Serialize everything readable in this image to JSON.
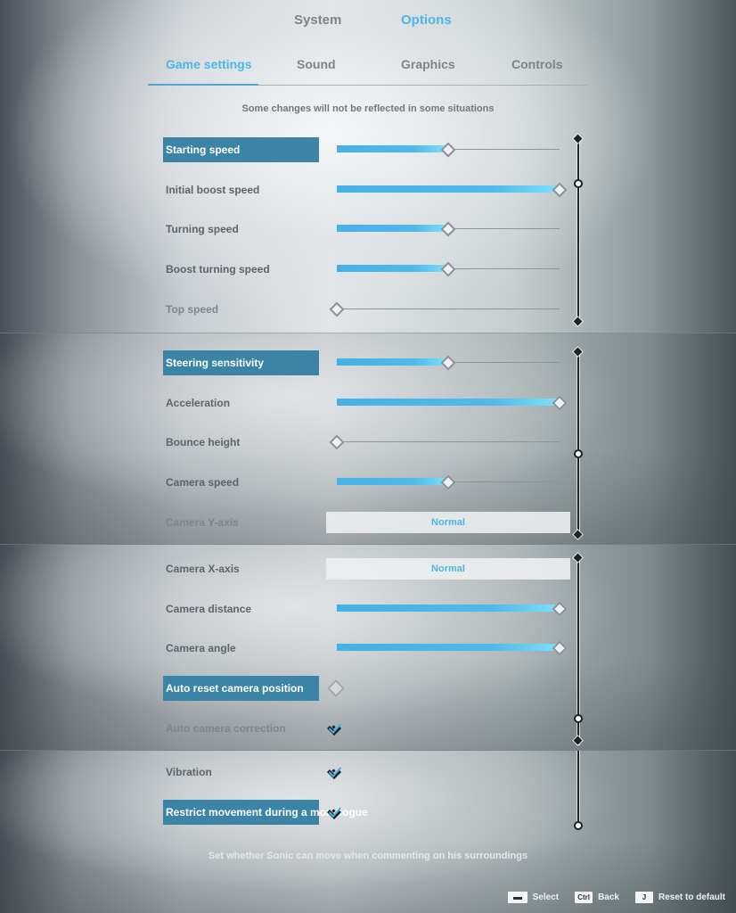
{
  "header": {
    "top_tabs": [
      {
        "label": "System",
        "active": false
      },
      {
        "label": "Options",
        "active": true
      }
    ],
    "sub_tabs": [
      {
        "label": "Game settings",
        "active": true
      },
      {
        "label": "Sound",
        "active": false
      },
      {
        "label": "Graphics",
        "active": false
      },
      {
        "label": "Controls",
        "active": false
      }
    ],
    "notice": "Some changes will not be reflected in some situations"
  },
  "panels": [
    {
      "settings": [
        {
          "label": "Starting speed",
          "type": "slider",
          "value": 0.5,
          "selected": true
        },
        {
          "label": "Initial boost speed",
          "type": "slider",
          "value": 1.0,
          "selected": false
        },
        {
          "label": "Turning speed",
          "type": "slider",
          "value": 0.5,
          "selected": false
        },
        {
          "label": "Boost turning speed",
          "type": "slider",
          "value": 0.5,
          "selected": false
        },
        {
          "label": "Top speed",
          "type": "slider",
          "value": 0.0,
          "selected": false,
          "dim": true
        }
      ],
      "scroll_position": 0.25
    },
    {
      "settings": [
        {
          "label": "Steering sensitivity",
          "type": "slider",
          "value": 0.5,
          "selected": true
        },
        {
          "label": "Acceleration",
          "type": "slider",
          "value": 1.0,
          "selected": false
        },
        {
          "label": "Bounce height",
          "type": "slider",
          "value": 0.0,
          "selected": false
        },
        {
          "label": "Camera speed",
          "type": "slider",
          "value": 0.5,
          "selected": false
        },
        {
          "label": "Camera Y-axis",
          "type": "select",
          "value": "Normal",
          "selected": false,
          "dim": true
        }
      ],
      "scroll_position": 0.55
    },
    {
      "settings": [
        {
          "label": "Camera X-axis",
          "type": "select",
          "value": "Normal",
          "selected": false
        },
        {
          "label": "Camera distance",
          "type": "slider",
          "value": 1.0,
          "selected": false
        },
        {
          "label": "Camera angle",
          "type": "slider",
          "value": 1.0,
          "selected": false
        },
        {
          "label": "Auto reset camera position",
          "type": "toggle",
          "value": false,
          "selected": true
        },
        {
          "label": "Auto camera correction",
          "type": "toggle",
          "value": true,
          "selected": false,
          "dim": true
        }
      ],
      "scroll_position": 0.85
    },
    {
      "settings": [
        {
          "label": "Vibration",
          "type": "toggle",
          "value": true,
          "selected": false
        },
        {
          "label": "Restrict movement during a monologue",
          "type": "toggle",
          "value": true,
          "selected": true
        }
      ],
      "scroll_position": 1.0,
      "hint": "Set whether Sonic can move when commenting on his surroundings"
    }
  ],
  "footer": [
    {
      "key": "space-key-icon",
      "key_label": "",
      "label": "Select"
    },
    {
      "key": "ctrl-key-icon",
      "key_label": "Ctrl",
      "label": "Back"
    },
    {
      "key": "j-key-icon",
      "key_label": "J",
      "label": "Reset to default"
    }
  ],
  "colors": {
    "accent": "#4db6e8",
    "selected_row": "#3c84a6",
    "label": "#5d646a"
  }
}
